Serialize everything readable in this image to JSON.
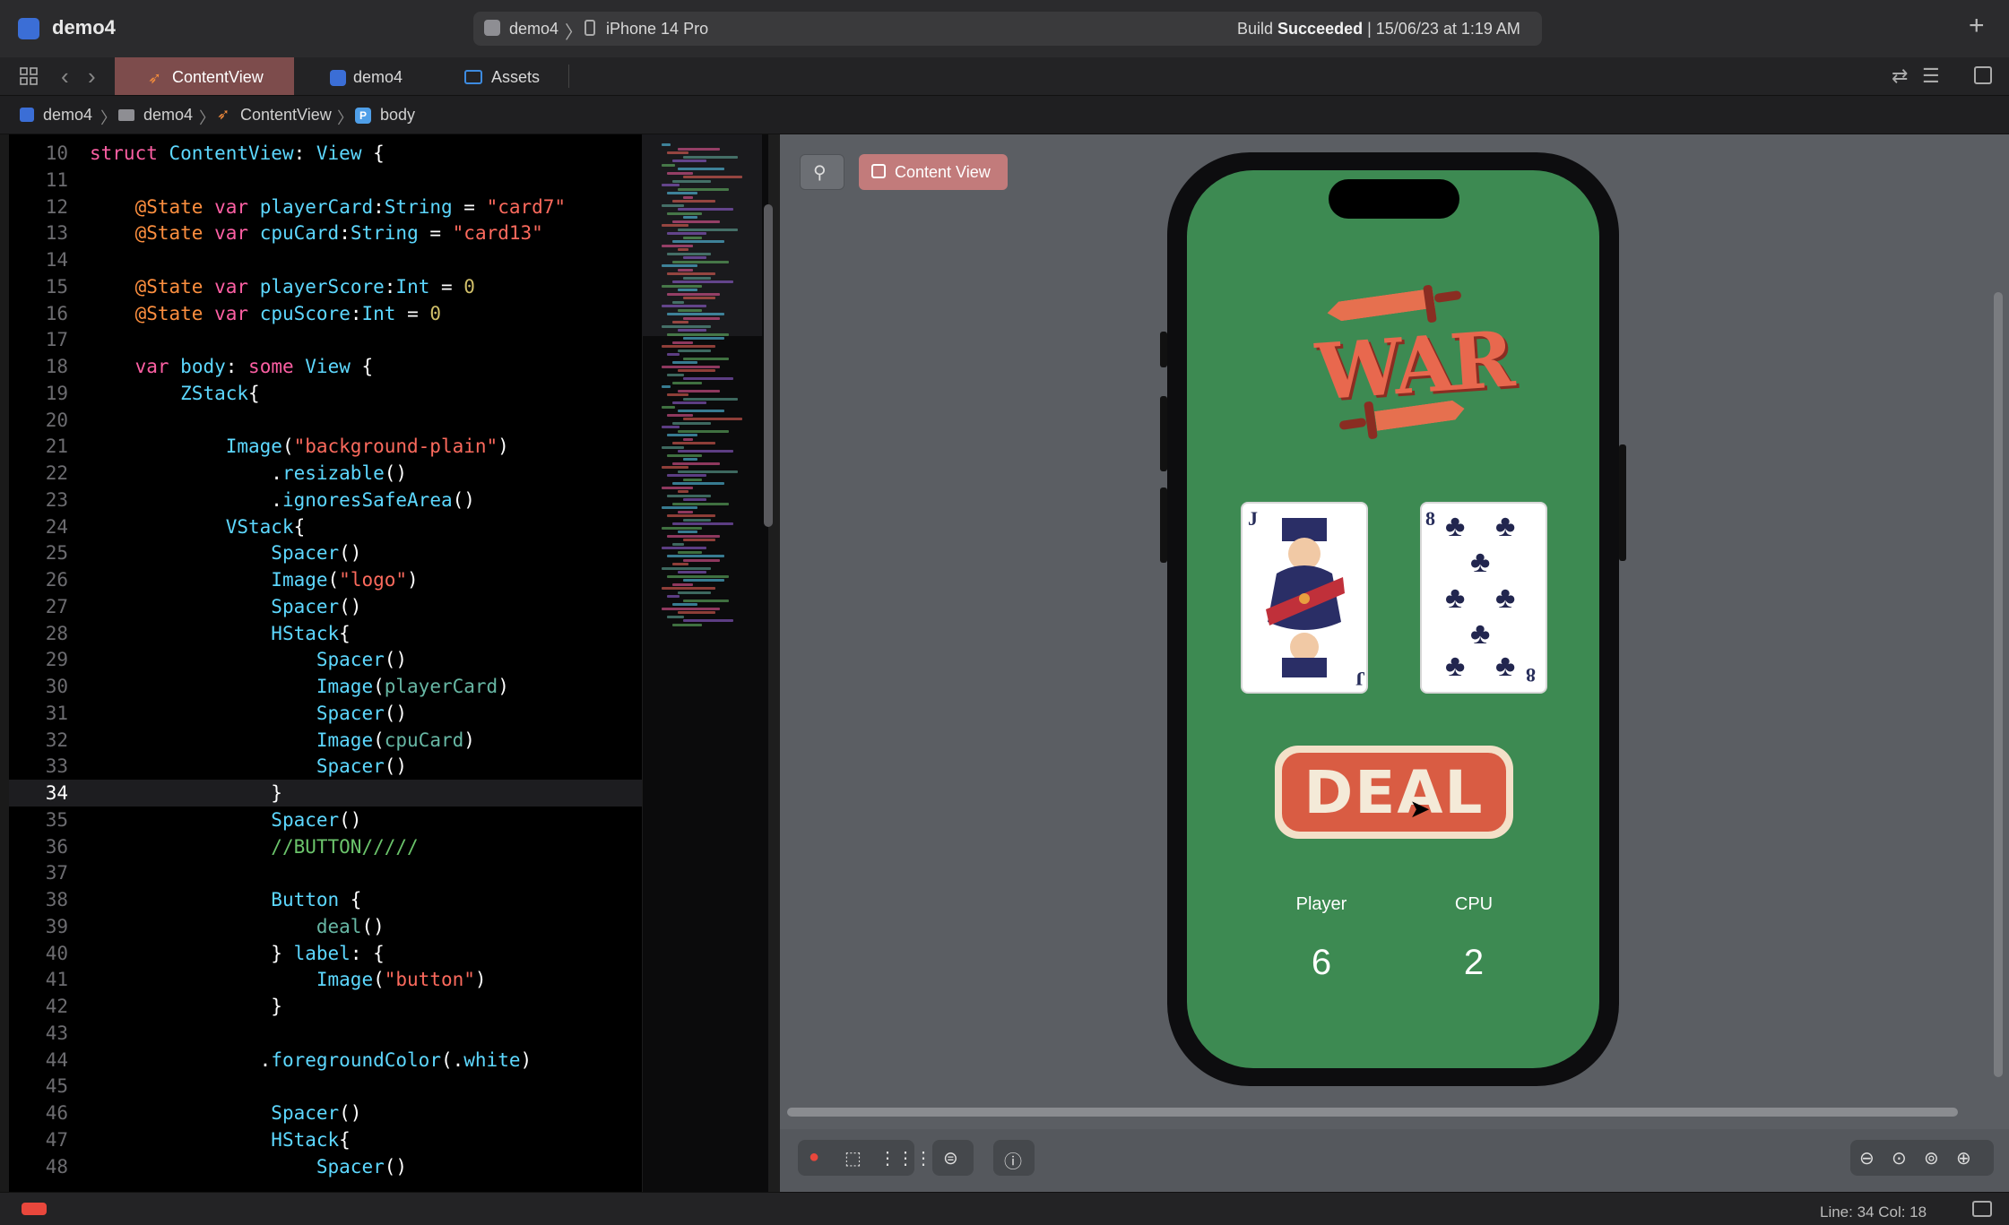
{
  "window": {
    "title": "demo4",
    "scheme": "demo4",
    "device": "iPhone 14 Pro",
    "build_status_prefix": "Build",
    "build_status_result": "Succeeded",
    "build_status_time": "| 15/06/23 at 1:19 AM"
  },
  "tabs": [
    {
      "label": "ContentView",
      "icon": "swift-file-icon",
      "active": true
    },
    {
      "label": "demo4",
      "icon": "project-icon",
      "active": false
    },
    {
      "label": "Assets",
      "icon": "asset-catalog-icon",
      "active": false
    }
  ],
  "breadcrumb": [
    "demo4",
    "demo4",
    "ContentView",
    "body"
  ],
  "breadcrumb_body_badge": "P",
  "code": {
    "current_line": 34,
    "lines": [
      {
        "n": "10",
        "html": "<span class='kw'>struct</span> <span class='ty'>ContentView</span><span class='pl'>: </span><span class='ty'>View</span><span class='pl'> {</span>"
      },
      {
        "n": "11",
        "html": ""
      },
      {
        "n": "12",
        "html": "    <span class='at'>@State</span> <span class='kw'>var</span> <span class='ty'>playerCard</span><span class='pl'>:</span><span class='ty'>String</span><span class='pl'> = </span><span class='str'>\"card7\"</span>"
      },
      {
        "n": "13",
        "html": "    <span class='at'>@State</span> <span class='kw'>var</span> <span class='ty'>cpuCard</span><span class='pl'>:</span><span class='ty'>String</span><span class='pl'> = </span><span class='str'>\"card13\"</span>"
      },
      {
        "n": "14",
        "html": ""
      },
      {
        "n": "15",
        "html": "    <span class='at'>@State</span> <span class='kw'>var</span> <span class='ty'>playerScore</span><span class='pl'>:</span><span class='ty'>Int</span><span class='pl'> = </span><span class='num'>0</span>"
      },
      {
        "n": "16",
        "html": "    <span class='at'>@State</span> <span class='kw'>var</span> <span class='ty'>cpuScore</span><span class='pl'>:</span><span class='ty'>Int</span><span class='pl'> = </span><span class='num'>0</span>"
      },
      {
        "n": "17",
        "html": ""
      },
      {
        "n": "18",
        "html": "    <span class='kw'>var</span> <span class='ty'>body</span><span class='pl'>: </span><span class='kw'>some</span> <span class='ty'>View</span><span class='pl'> {</span>"
      },
      {
        "n": "19",
        "html": "        <span class='ty'>ZStack</span><span class='pl'>{</span>"
      },
      {
        "n": "20",
        "html": ""
      },
      {
        "n": "21",
        "html": "            <span class='ty'>Image</span><span class='pl'>(</span><span class='str'>\"background-plain\"</span><span class='pl'>)</span>"
      },
      {
        "n": "22",
        "html": "                <span class='pl'>.</span><span class='ty'>resizable</span><span class='pl'>()</span>"
      },
      {
        "n": "23",
        "html": "                <span class='pl'>.</span><span class='ty'>ignoresSafeArea</span><span class='pl'>()</span>"
      },
      {
        "n": "24",
        "html": "            <span class='ty'>VStack</span><span class='pl'>{</span>"
      },
      {
        "n": "25",
        "html": "                <span class='ty'>Spacer</span><span class='pl'>()</span>"
      },
      {
        "n": "26",
        "html": "                <span class='ty'>Image</span><span class='pl'>(</span><span class='str'>\"logo\"</span><span class='pl'>)</span>"
      },
      {
        "n": "27",
        "html": "                <span class='ty'>Spacer</span><span class='pl'>()</span>"
      },
      {
        "n": "28",
        "html": "                <span class='ty'>HStack</span><span class='pl'>{</span>"
      },
      {
        "n": "29",
        "html": "                    <span class='ty'>Spacer</span><span class='pl'>()</span>"
      },
      {
        "n": "30",
        "html": "                    <span class='ty'>Image</span><span class='pl'>(</span><span class='id'>playerCard</span><span class='pl'>)</span>"
      },
      {
        "n": "31",
        "html": "                    <span class='ty'>Spacer</span><span class='pl'>()</span>"
      },
      {
        "n": "32",
        "html": "                    <span class='ty'>Image</span><span class='pl'>(</span><span class='id'>cpuCard</span><span class='pl'>)</span>"
      },
      {
        "n": "33",
        "html": "                    <span class='ty'>Spacer</span><span class='pl'>()</span>"
      },
      {
        "n": "34",
        "html": "                <span class='pl'>}</span>"
      },
      {
        "n": "35",
        "html": "                <span class='ty'>Spacer</span><span class='pl'>()</span>"
      },
      {
        "n": "36",
        "html": "                <span class='cm'>//BUTTON/////</span>"
      },
      {
        "n": "37",
        "html": ""
      },
      {
        "n": "38",
        "html": "                <span class='ty'>Button</span><span class='pl'> {</span>"
      },
      {
        "n": "39",
        "html": "                    <span class='id'>deal</span><span class='pl'>()</span>"
      },
      {
        "n": "40",
        "html": "                <span class='pl'>} </span><span class='ty'>label</span><span class='pl'>: {</span>"
      },
      {
        "n": "41",
        "html": "                    <span class='ty'>Image</span><span class='pl'>(</span><span class='str'>\"button\"</span><span class='pl'>)</span>"
      },
      {
        "n": "42",
        "html": "                <span class='pl'>}</span>"
      },
      {
        "n": "43",
        "html": ""
      },
      {
        "n": "44",
        "html": "               <span class='pl'>.</span><span class='ty'>foregroundColor</span><span class='pl'>(.</span><span class='ty'>white</span><span class='pl'>)</span>"
      },
      {
        "n": "45",
        "html": ""
      },
      {
        "n": "46",
        "html": "                <span class='ty'>Spacer</span><span class='pl'>()</span>"
      },
      {
        "n": "47",
        "html": "                <span class='ty'>HStack</span><span class='pl'>{</span>"
      },
      {
        "n": "48",
        "html": "                    <span class='ty'>Spacer</span><span class='pl'>()</span>"
      }
    ]
  },
  "preview": {
    "pin_icon": "pin-icon",
    "label": "Content View",
    "game": {
      "logo": "WAR",
      "player_card_rank": "J",
      "cpu_card_rank": "8",
      "deal_label": "DEAL",
      "player_label": "Player",
      "cpu_label": "CPU",
      "player_score": "6",
      "cpu_score": "2"
    }
  },
  "status": {
    "position": "Line: 34  Col: 18"
  },
  "colors": {
    "game_background": "#3d8a52",
    "active_tab": "#7d4c4c",
    "deal_button": "#d95c43",
    "content_view_chip": "#c27b7b"
  }
}
